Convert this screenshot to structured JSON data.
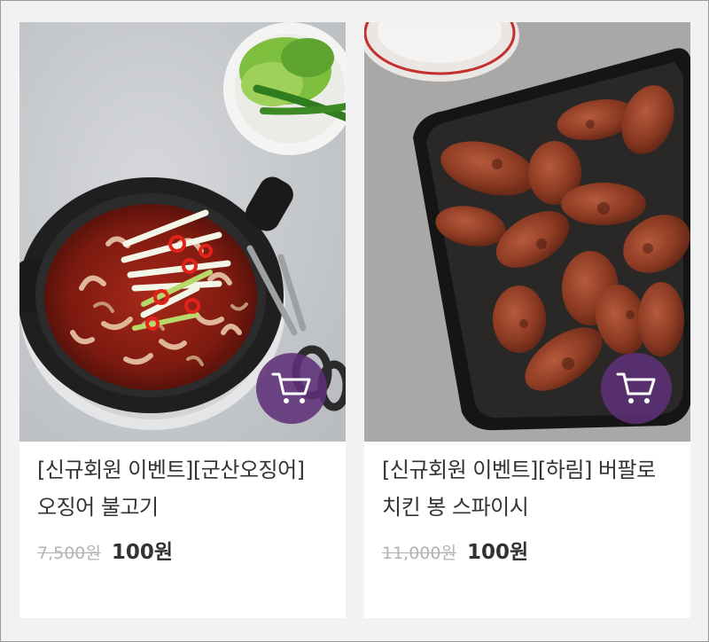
{
  "products": [
    {
      "title": "[신규회원 이벤트][군산오징어] 오징어 불고기",
      "original_price": "7,500원",
      "sale_price": "100원",
      "image_alt": "오징어 불고기",
      "cart_icon": "cart-icon"
    },
    {
      "title": "[신규회원 이벤트][하림] 버팔로 치킨 봉 스파이시",
      "original_price": "11,000원",
      "sale_price": "100원",
      "image_alt": "버팔로 치킨 봉 스파이시",
      "cart_icon": "cart-icon"
    }
  ],
  "colors": {
    "cart_button": "#5e3078",
    "background": "#f2f2f2",
    "card": "#ffffff",
    "text": "#333333",
    "strike_price": "#b3b3b3"
  }
}
